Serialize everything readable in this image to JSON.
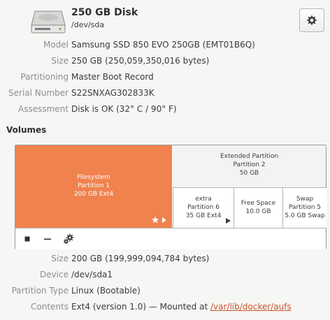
{
  "disk": {
    "title": "250 GB Disk",
    "device": "/dev/sda"
  },
  "disk_info": {
    "model_label": "Model",
    "model": "Samsung SSD 850 EVO 250GB (EMT01B6Q)",
    "size_label": "Size",
    "size": "250 GB (250,059,350,016 bytes)",
    "partitioning_label": "Partitioning",
    "partitioning": "Master Boot Record",
    "serial_label": "Serial Number",
    "serial": "S22SNXAG302833K",
    "assessment_label": "Assessment",
    "assessment": "Disk is OK (32° C / 90° F)"
  },
  "volumes": {
    "heading": "Volumes",
    "partition1": {
      "line1": "Filesystem",
      "line2": "Partition 1",
      "line3": "200 GB Ext4"
    },
    "extended": {
      "line1": "Extended Partition",
      "line2": "Partition 2",
      "line3": "50 GB"
    },
    "partition6": {
      "line1": "extra",
      "line2": "Partition 6",
      "line3": "35 GB Ext4"
    },
    "free_space": {
      "line1": "Free Space",
      "line2": "10.0 GB"
    },
    "partition5": {
      "line1": "Swap",
      "line2": "Partition 5",
      "line3": "5.0 GB Swap"
    }
  },
  "volume_info": {
    "size_label": "Size",
    "size": "200 GB (199,999,094,784 bytes)",
    "device_label": "Device",
    "device": "/dev/sda1",
    "type_label": "Partition Type",
    "type": "Linux (Bootable)",
    "contents_label": "Contents",
    "contents_prefix": "Ext4 (version 1.0) — Mounted at ",
    "mount_link": "/var/lib/docker/aufs"
  },
  "icons": {
    "disk": "hard-disk-icon",
    "settings": "gear-icon",
    "stop": "stop-icon",
    "delete": "minus-icon",
    "more": "gears-icon",
    "mounted": "star-icon",
    "expand": "play-arrow-icon"
  },
  "colors": {
    "selected_partition": "#f0824e",
    "link": "#c8542a"
  }
}
